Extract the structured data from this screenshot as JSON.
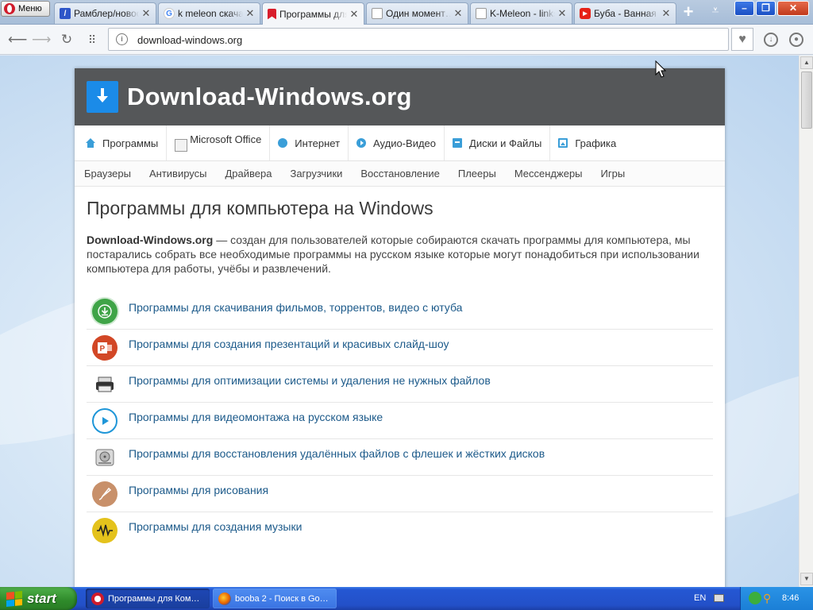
{
  "browser": {
    "menu_label": "Меню",
    "tabs": [
      {
        "title": "Рамблер/новости",
        "favicon": "rambler-icon",
        "active": false
      },
      {
        "title": "k meleon скачать",
        "favicon": "google-icon",
        "active": false
      },
      {
        "title": "Программы для компьютера",
        "favicon": "bookmark-icon",
        "active": true
      },
      {
        "title": "Один момент…",
        "favicon": "page-icon",
        "active": false
      },
      {
        "title": "K-Meleon - links",
        "favicon": "page-icon",
        "active": false
      },
      {
        "title": "Буба - Ванная",
        "favicon": "youtube-icon",
        "active": false
      }
    ],
    "address": "download-windows.org",
    "window_buttons": {
      "minimize": "–",
      "restore": "❐",
      "close": "✕"
    }
  },
  "site": {
    "title": "Download-Windows.org",
    "main_nav": [
      {
        "label": "Программы",
        "icon": "home-icon"
      },
      {
        "label": "Microsoft Office",
        "icon": "broken-image-icon"
      },
      {
        "label": "Интернет",
        "icon": "globe-icon"
      },
      {
        "label": "Аудио-Видео",
        "icon": "play-icon"
      },
      {
        "label": "Диски и Файлы",
        "icon": "archive-icon"
      },
      {
        "label": "Графика",
        "icon": "image-icon"
      }
    ],
    "sub_nav": [
      "Браузеры",
      "Антивирусы",
      "Драйвера",
      "Загрузчики",
      "Восстановление",
      "Плееры",
      "Мессенджеры",
      "Игры"
    ],
    "heading": "Программы для компьютера на Windows",
    "intro_strong": "Download-Windows.org",
    "intro_text": " — создан для пользователей которые собираются скачать программы для компьютера, мы постарались собрать все необходимые программы на русском языке которые могут понадобиться при использовании компьютера для работы, учёбы и развлечений.",
    "categories": [
      {
        "label": "Программы для скачивания фильмов, торрентов, видео с ютуба",
        "icon": "download-icon",
        "color": "#3fa447"
      },
      {
        "label": "Программы для создания презентаций и красивых слайд-шоу",
        "icon": "powerpoint-icon",
        "color": "#d24726"
      },
      {
        "label": "Программы для оптимизации системы и удаления не нужных файлов",
        "icon": "printer-icon",
        "color": "#333333"
      },
      {
        "label": "Программы для видеомонтажа на русском языке",
        "icon": "play-circle-icon",
        "color": "#1e96d8"
      },
      {
        "label": "Программы для восстановления удалённых файлов с флешек и жёстких дисков",
        "icon": "hard-drive-icon",
        "color": "#9a9a9a"
      },
      {
        "label": "Программы для рисования",
        "icon": "paint-icon",
        "color": "#c8906a"
      },
      {
        "label": "Программы для создания музыки",
        "icon": "waveform-icon",
        "color": "#e4c21c"
      }
    ]
  },
  "taskbar": {
    "start_label": "start",
    "tasks": [
      {
        "label": "Программы для Ком…",
        "icon": "opera-icon",
        "active": true
      },
      {
        "label": "booba 2 - Поиск в Go…",
        "icon": "firefox-icon",
        "active": false
      }
    ],
    "language": "EN",
    "time": "8:46"
  }
}
